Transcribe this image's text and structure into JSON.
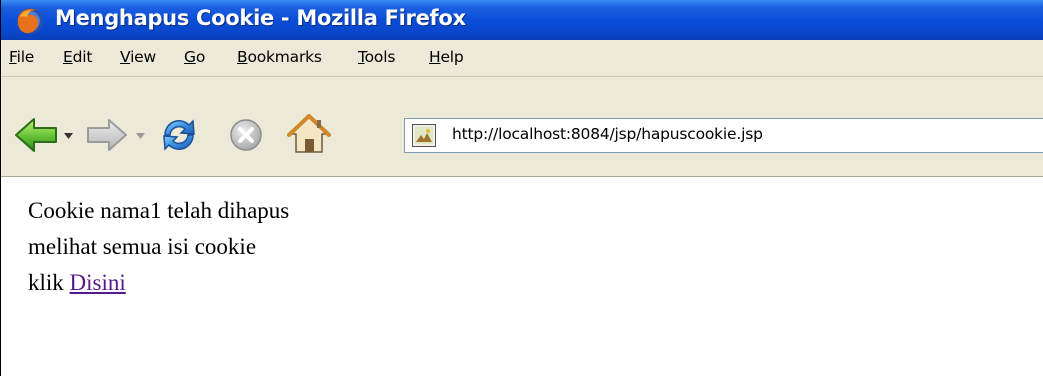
{
  "window": {
    "title": "Menghapus Cookie - Mozilla Firefox"
  },
  "menubar": {
    "items": [
      {
        "label": "File",
        "accesskey": "F",
        "rest": "ile"
      },
      {
        "label": "Edit",
        "accesskey": "E",
        "rest": "dit"
      },
      {
        "label": "View",
        "accesskey": "V",
        "rest": "iew"
      },
      {
        "label": "Go",
        "accesskey": "G",
        "rest": "o"
      },
      {
        "label": "Bookmarks",
        "accesskey": "B",
        "rest": "ookmarks"
      },
      {
        "label": "Tools",
        "accesskey": "T",
        "rest": "ools"
      },
      {
        "label": "Help",
        "accesskey": "H",
        "rest": "elp"
      }
    ]
  },
  "toolbar": {
    "back_icon": "back-arrow-icon",
    "back_dropdown_icon": "dropdown-arrow-icon",
    "forward_icon": "forward-arrow-icon",
    "forward_dropdown_icon": "dropdown-arrow-icon",
    "reload_icon": "reload-icon",
    "stop_icon": "stop-icon",
    "home_icon": "home-icon",
    "address": {
      "icon": "page-favicon",
      "url": "http://localhost:8084/jsp/hapuscookie.jsp"
    }
  },
  "page": {
    "line1": "Cookie nama1 telah dihapus",
    "line2": "melihat semua isi cookie",
    "line3_prefix": "klik ",
    "link_text": "Disini"
  },
  "colors": {
    "titlebar": "#0a4ed8",
    "chrome": "#ece9d8",
    "visited_link": "#551a8b"
  }
}
